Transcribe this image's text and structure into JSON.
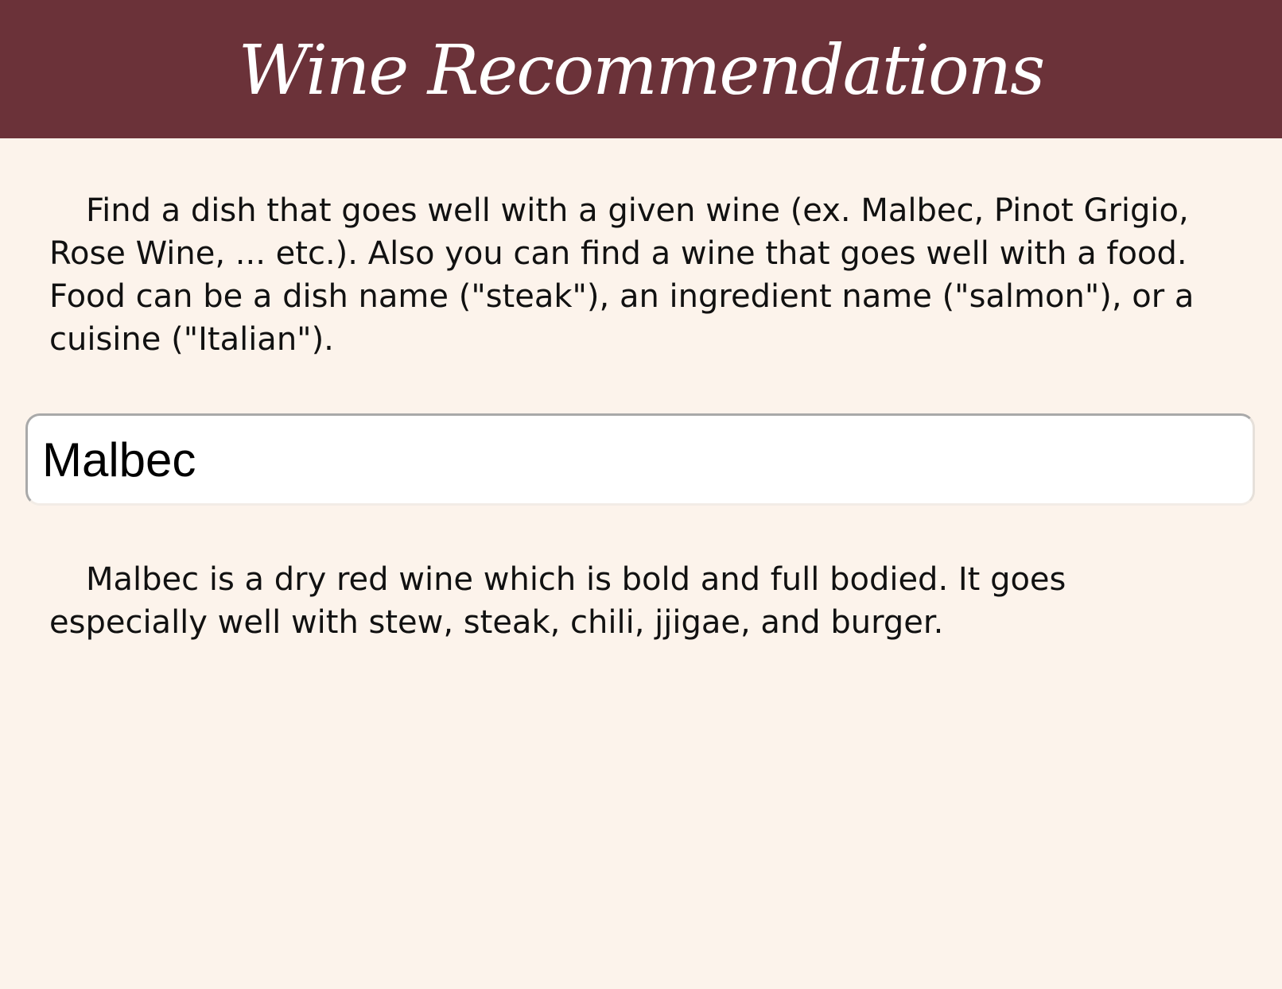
{
  "header": {
    "title": "Wine Recommendations"
  },
  "intro": {
    "text": "Find a dish that goes well with a given wine (ex. Malbec, Pinot Grigio, Rose Wine, ... etc.). Also you can find a wine that goes well with a food. Food can be a dish name (\"steak\"), an ingredient name (\"salmon\"), or a cuisine (\"Italian\")."
  },
  "search": {
    "value": "Malbec"
  },
  "result": {
    "text": "Malbec is a dry red wine which is bold and full bodied. It goes especially well with stew, steak, chili, jjigae, and burger."
  },
  "colors": {
    "header_bg": "#6b3239",
    "page_bg": "#fcf3eb",
    "text": "#111111"
  }
}
